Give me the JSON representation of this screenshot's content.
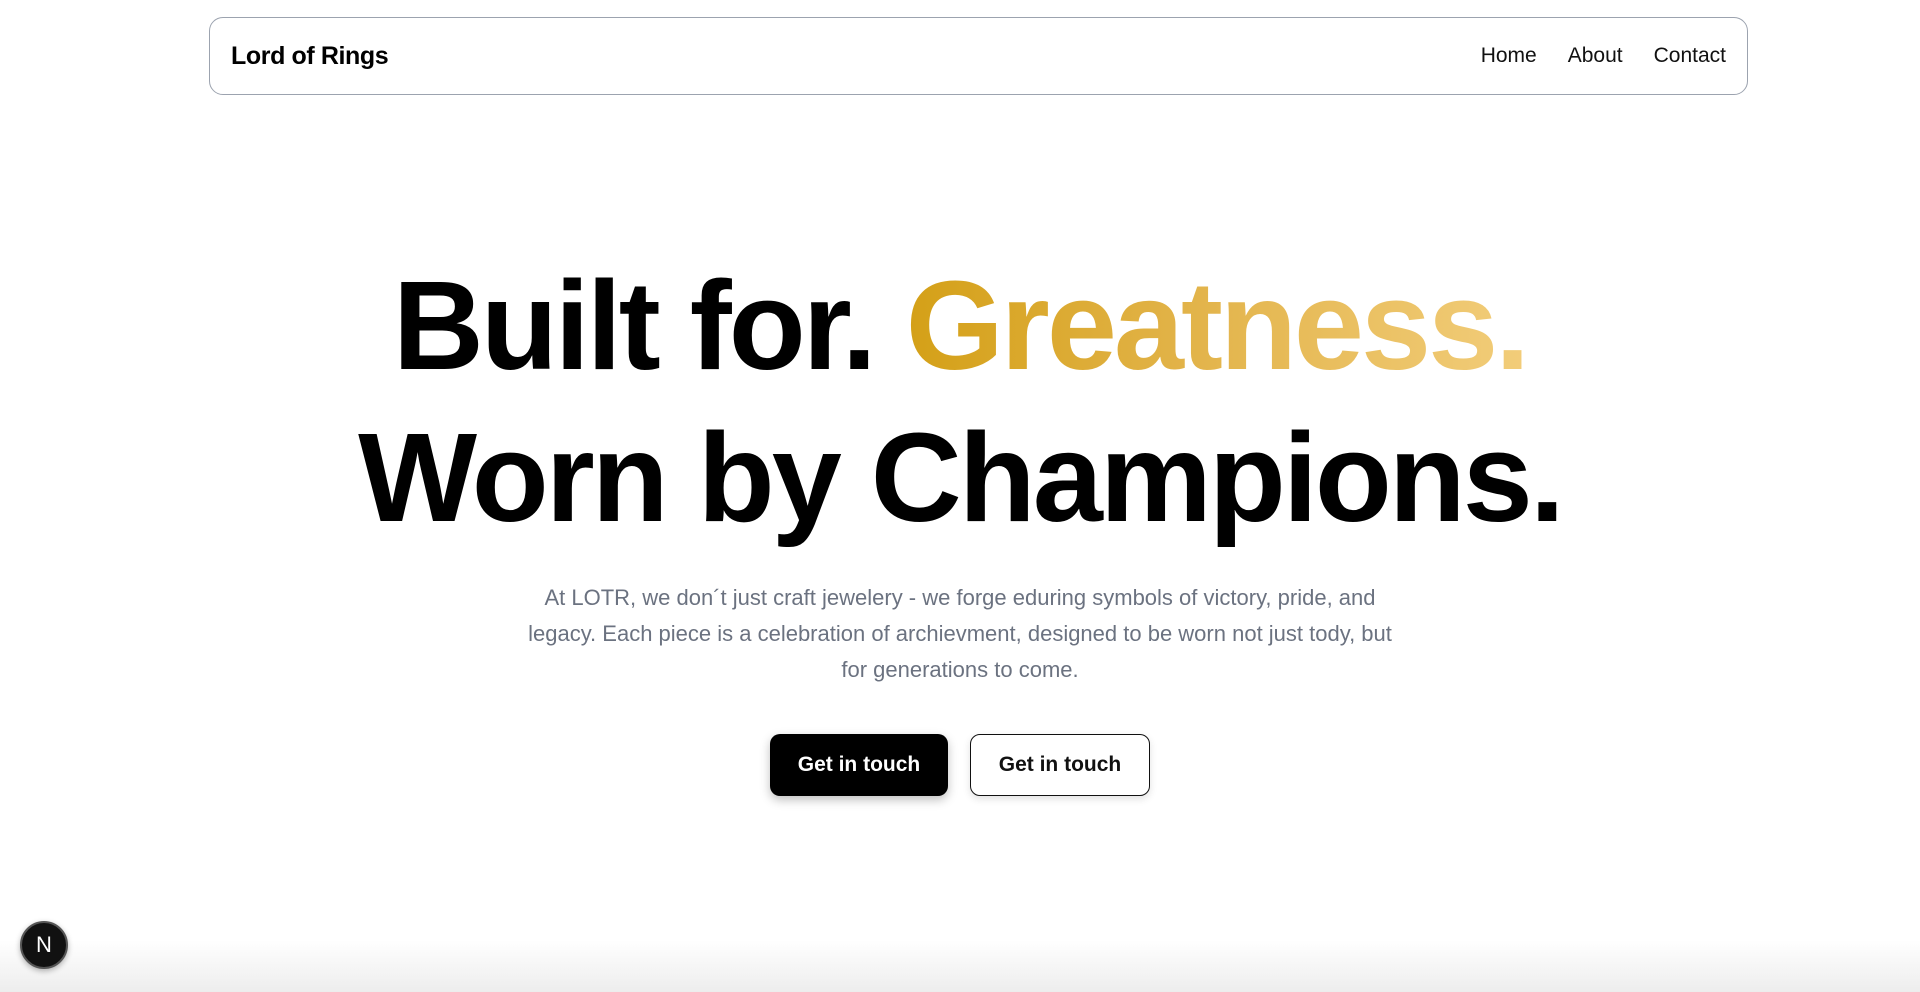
{
  "navbar": {
    "brand": "Lord of Rings",
    "links": [
      {
        "label": "Home"
      },
      {
        "label": "About"
      },
      {
        "label": "Contact"
      }
    ]
  },
  "hero": {
    "line1_plain": "Built for. ",
    "line1_accent": "Greatness.",
    "line2": "Worn by Champions.",
    "description": "At LOTR, we don´t just craft jewelery - we forge eduring symbols of victory, pride, and legacy. Each piece is a celebration of archievment, designed to be worn not just tody, but for generations to come.",
    "primary_button": "Get in touch",
    "secondary_button": "Get in touch"
  },
  "dev_badge": {
    "label": "N",
    "icon": "nextjs-icon"
  },
  "colors": {
    "accent_start": "#d4a017",
    "accent_end": "#f2cd7a",
    "description_text": "#6b7280"
  }
}
